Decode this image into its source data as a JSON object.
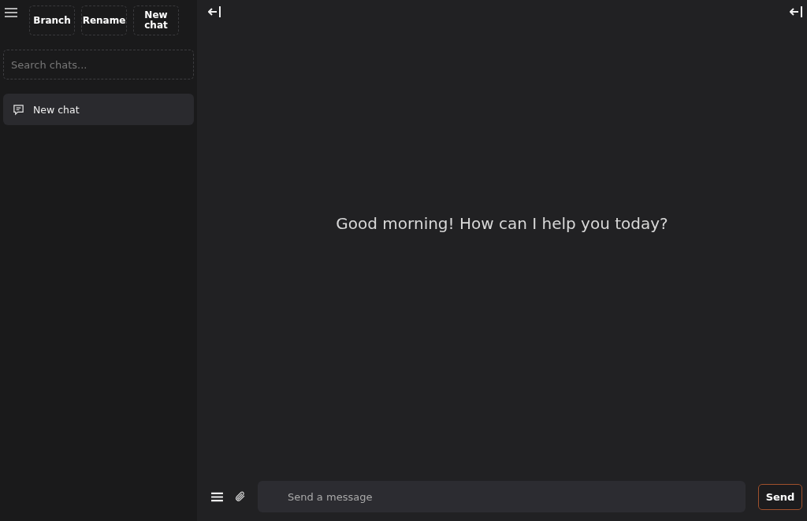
{
  "sidebar": {
    "buttons": [
      "Branch",
      "Rename",
      "New chat"
    ],
    "search": {
      "placeholder": "Search chats..."
    },
    "chats": [
      {
        "title": "New chat",
        "selected": true
      }
    ]
  },
  "main": {
    "greeting": "Good morning! How can I help you today?"
  },
  "composer": {
    "placeholder": "Send a message",
    "send": "Send"
  }
}
